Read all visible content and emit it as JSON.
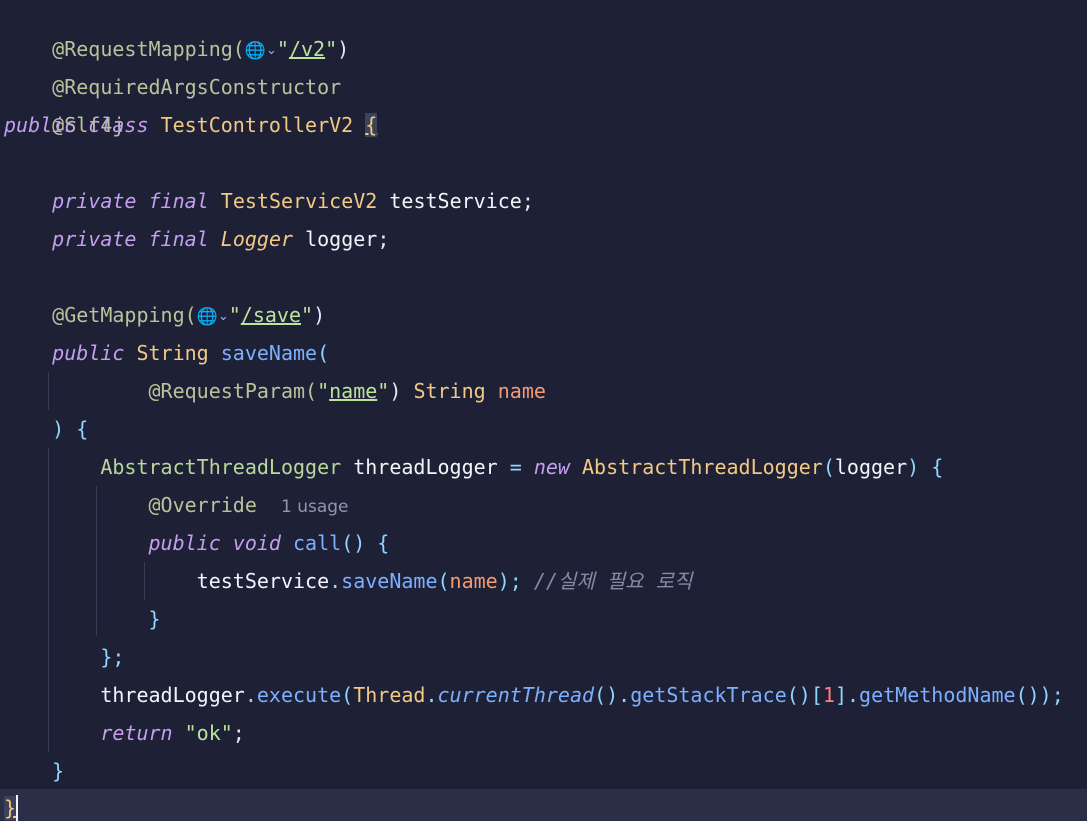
{
  "code": {
    "ann_request_mapping": "@RequestMapping(",
    "v2_path": "/v2",
    "ann_required_args": "@RequiredArgsConstructor",
    "ann_slf4j": "@Slf4j",
    "kw_public": "public",
    "kw_class": "class",
    "class_name": "TestControllerV2",
    "open_brace": "{",
    "kw_private": "private",
    "kw_final": "final",
    "type_service": "TestServiceV2",
    "field_service": "testService",
    "semicolon": ";",
    "type_logger": "Logger",
    "field_logger": "logger",
    "ann_get_mapping": "@GetMapping(",
    "save_path": "/save",
    "quote": "\"",
    "close_paren": ")",
    "type_string": "String",
    "method_save_name": "saveName",
    "open_paren": "(",
    "ann_request_param": "@RequestParam(",
    "param_name_literal": "name",
    "param_name": "name",
    "close_paren_brace": ") {",
    "type_abstract_logger": "AbstractThreadLogger",
    "var_thread_logger": "threadLogger",
    "op_assign": "=",
    "kw_new": "new",
    "arg_logger": "logger",
    "ann_override": "@Override",
    "usage_hint": "1 usage",
    "kw_void": "void",
    "method_call": "call",
    "parens_brace": "() {",
    "service_ref": "testService",
    "dot": ".",
    "arg_name": "name",
    "close_paren_semi": ");",
    "comment": "//실제 필요 로직",
    "close_brace": "}",
    "close_brace_semi": "};",
    "method_execute": "execute",
    "type_thread": "Thread",
    "method_current_thread": "currentThread",
    "method_get_stack_trace": "getStackTrace",
    "index_open": "[",
    "index_value": "1",
    "index_close": "]",
    "method_get_method_name": "getMethodName",
    "tail_parens": "());",
    "kw_return": "return",
    "return_value": "\"ok\"",
    "empty_parens": "()"
  },
  "icons": {
    "globe": "web-globe-icon",
    "chevron": "chevron-down-icon"
  },
  "colors": {
    "background": "#1e2136",
    "annotation": "#b9c29a",
    "keyword": "#c59ef0",
    "type": "#f2c983",
    "string": "#bce39c",
    "function": "#7dafff",
    "parameter": "#f29a74",
    "comment": "#858aa6"
  }
}
